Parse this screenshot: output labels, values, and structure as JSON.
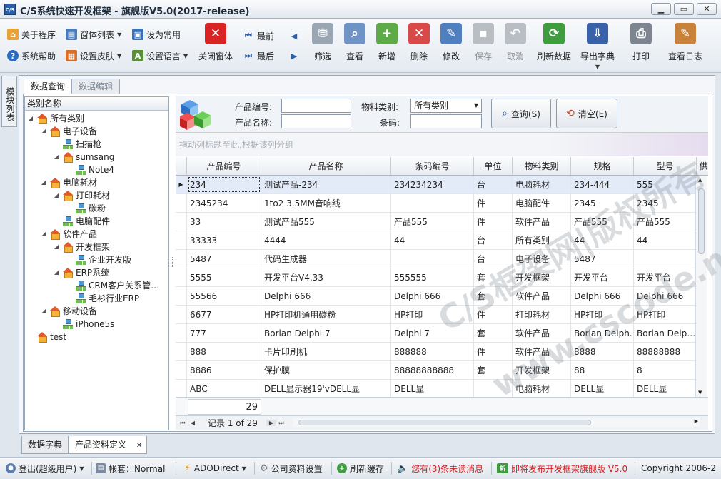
{
  "window": {
    "title": "C/S系统快速开发框架 - 旗舰版V5.0(2017-release)",
    "app_icon": "C/S"
  },
  "toolbar": {
    "small": {
      "about": "关于程序",
      "help": "系统帮助",
      "window_list": "窗体列表",
      "skin": "设置皮肤",
      "set_common": "设为常用",
      "language": "设置语言"
    },
    "close_window": "关闭窗体",
    "first": "最前",
    "last": "最后",
    "filter": "筛选",
    "view": "查看",
    "add": "新增",
    "delete": "删除",
    "edit": "修改",
    "save": "保存",
    "cancel": "取消",
    "refresh": "刷新数据",
    "export": "导出字典",
    "print": "打印",
    "log": "查看日志"
  },
  "side_tab": "模块列表",
  "tabs": {
    "query": "数据查询",
    "edit": "数据编辑"
  },
  "tree": {
    "header": "类别名称",
    "nodes": [
      {
        "label": "所有类别"
      },
      {
        "label": "电子设备"
      },
      {
        "label": "扫描枪"
      },
      {
        "label": "sumsang"
      },
      {
        "label": "Note4"
      },
      {
        "label": "电脑耗材"
      },
      {
        "label": "打印耗材"
      },
      {
        "label": "碳粉"
      },
      {
        "label": "电脑配件"
      },
      {
        "label": "软件产品"
      },
      {
        "label": "开发框架"
      },
      {
        "label": "企业开发版"
      },
      {
        "label": "ERP系统"
      },
      {
        "label": "CRM客户关系管…"
      },
      {
        "label": "毛衫行业ERP"
      },
      {
        "label": "移动设备"
      },
      {
        "label": "iPhone5s"
      },
      {
        "label": "test"
      }
    ]
  },
  "filter": {
    "product_no_label": "产品编号:",
    "product_name_label": "产品名称:",
    "category_label": "物料类别:",
    "category_value": "所有类别",
    "barcode_label": "条码:",
    "query_button": "查询(S)",
    "clear_button": "清空(E)"
  },
  "grid": {
    "group_hint": "拖动列标题至此,根据该列分组",
    "columns": [
      "产品编号",
      "产品名称",
      "条码编号",
      "单位",
      "物料类别",
      "规格",
      "型号",
      "供"
    ],
    "rows": [
      [
        "234",
        "测试产品-234",
        "234234234",
        "台",
        "电脑耗材",
        "234-444",
        "555"
      ],
      [
        "2345234",
        "1to2 3.5MM音响线",
        "",
        "件",
        "电脑配件",
        "2345",
        "2345"
      ],
      [
        "33",
        "测试产品555",
        "产品555",
        "件",
        "软件产品",
        "产品555",
        "产品555"
      ],
      [
        "33333",
        "4444",
        "44",
        "台",
        "所有类别",
        "44",
        "44"
      ],
      [
        "5487",
        "代码生成器",
        "",
        "台",
        "电子设备",
        "5487",
        ""
      ],
      [
        "5555",
        "开发平台V4.33",
        "555555",
        "套",
        "开发框架",
        "开发平台",
        "开发平台"
      ],
      [
        "55566",
        "Delphi 666",
        "Delphi 666",
        "套",
        "软件产品",
        "Delphi 666",
        "Delphi 666"
      ],
      [
        "6677",
        "HP打印机通用碳粉",
        "HP打印",
        "件",
        "打印耗材",
        "HP打印",
        "HP打印"
      ],
      [
        "777",
        "Borlan Delphi 7",
        "Delphi 7",
        "套",
        "软件产品",
        "Borlan Delph…",
        "Borlan Delp…"
      ],
      [
        "888",
        "卡片印刷机",
        "888888",
        "件",
        "软件产品",
        "8888",
        "88888888"
      ],
      [
        "8886",
        "保护膜",
        "88888888888",
        "套",
        "开发框架",
        "88",
        "8"
      ],
      [
        "ABC",
        "DELL显示器19'vDELL显",
        "DELL显",
        "",
        "电脑耗材",
        "DELL显",
        "DELL显"
      ]
    ],
    "footer_count": "29",
    "nav_text": "记录 1 of 29"
  },
  "watermark": {
    "line1": "C/S框架网|版权所有",
    "line2": "www.cscode.net"
  },
  "bottom_tabs": {
    "dict": "数据字典",
    "product": "产品资料定义",
    "close": "✕"
  },
  "status": {
    "login": "登出(超级用户)",
    "account": "帐套：Normal",
    "db": "ADODirect",
    "company": "公司资料设置",
    "cache": "刷新缓存",
    "message": "您有(3)条未读消息",
    "release": "即将发布开发框架旗舰版 V5.0",
    "copyright": "Copyright 2006-2"
  },
  "colors": {
    "accent": "#2b5fa8",
    "selected_row": "#e3ebf8",
    "alert_red": "#d21f1f"
  }
}
